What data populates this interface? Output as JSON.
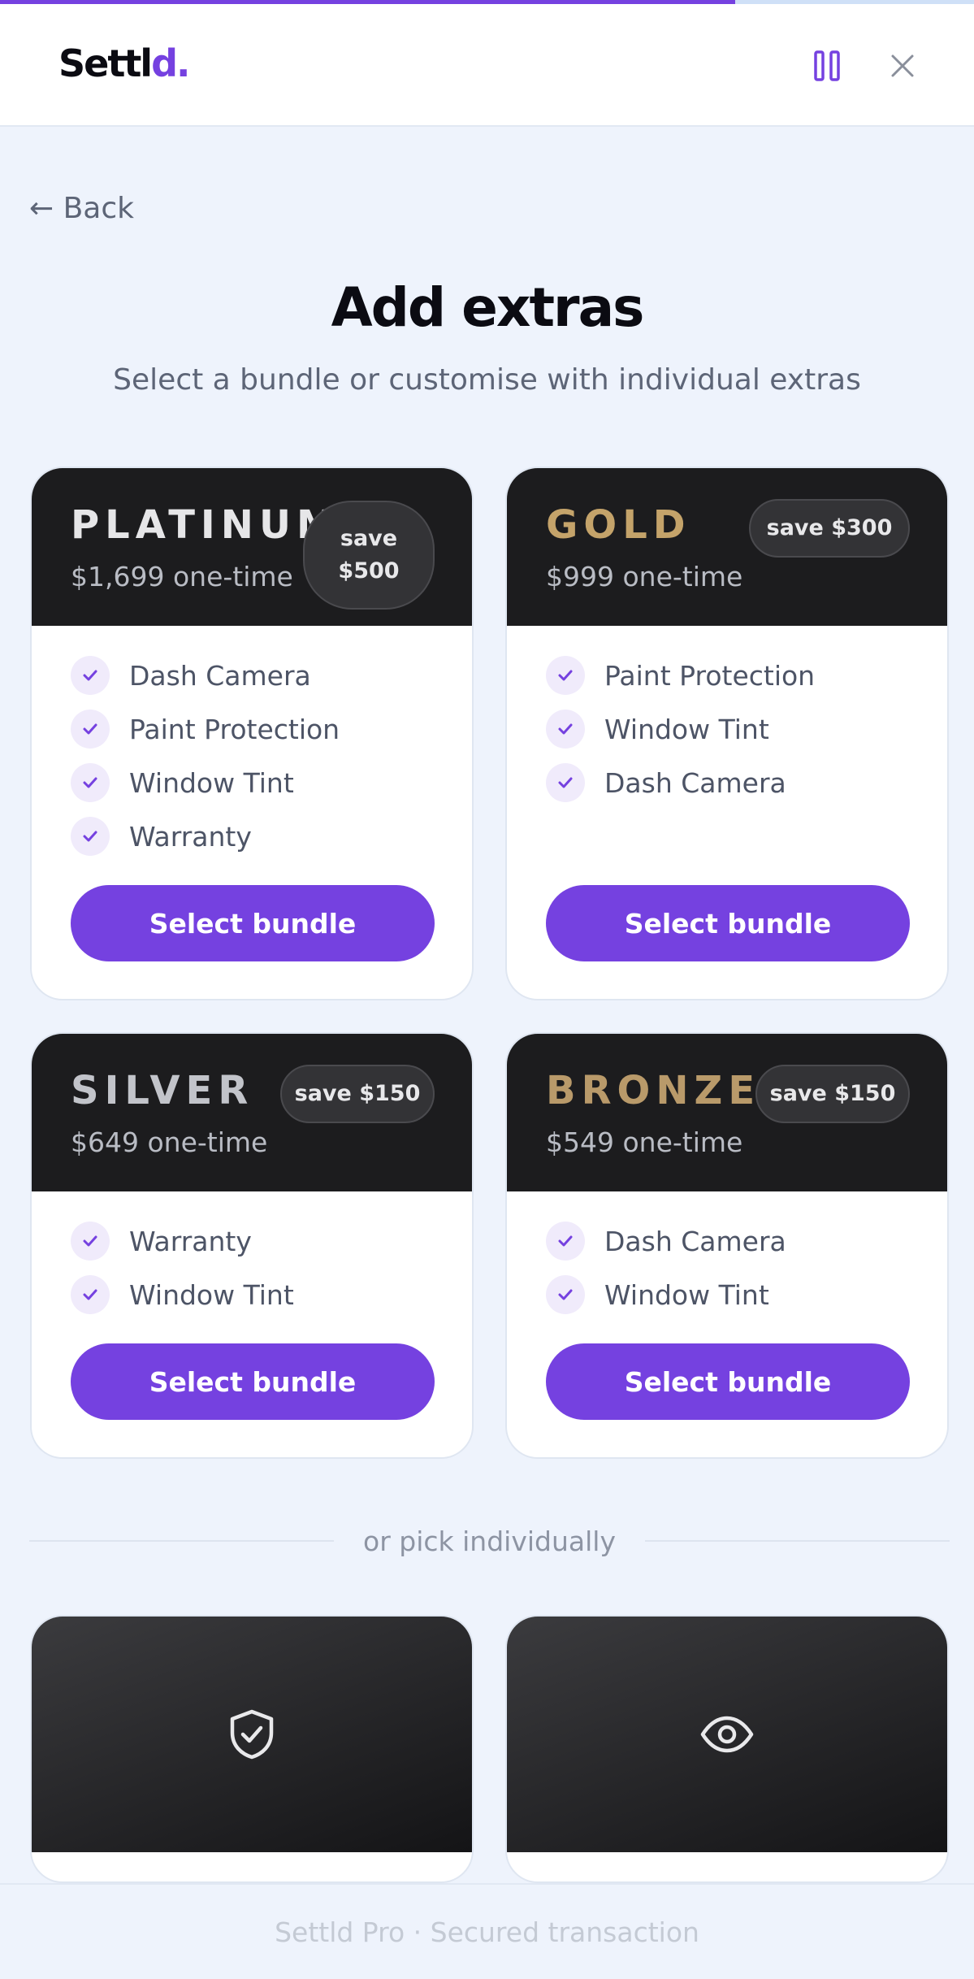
{
  "progress": {
    "fraction": 0.755
  },
  "header": {
    "logo_main": "Settl",
    "logo_accent": "d.",
    "pause_icon": "pause-icon",
    "close_icon": "close-icon"
  },
  "nav": {
    "back_label": "← Back"
  },
  "page": {
    "title": "Add extras",
    "subtitle": "Select a bundle or customise with individual extras"
  },
  "bundles": [
    {
      "tier": "PLATINUM",
      "tier_color": "#e6e6e8",
      "price": "$1,699 one-time",
      "save_line1": "save",
      "save_line2": "$500",
      "features": [
        "Dash Camera",
        "Paint Protection",
        "Window Tint",
        "Warranty"
      ],
      "button": "Select bundle"
    },
    {
      "tier": "GOLD",
      "tier_color": "#c4a36a",
      "price": "$999 one-time",
      "save": "save $300",
      "features": [
        "Paint Protection",
        "Window Tint",
        "Dash Camera"
      ],
      "button": "Select bundle"
    },
    {
      "tier": "SILVER",
      "tier_color": "#c2c4ca",
      "price": "$649 one-time",
      "save": "save $150",
      "features": [
        "Warranty",
        "Window Tint"
      ],
      "button": "Select bundle"
    },
    {
      "tier": "BRONZE",
      "tier_color": "#b99a6a",
      "price": "$549 one-time",
      "save": "save $150",
      "features": [
        "Dash Camera",
        "Window Tint"
      ],
      "button": "Select bundle"
    }
  ],
  "divider": {
    "label": "or pick individually"
  },
  "extras": [
    {
      "icon": "shield-check-icon"
    },
    {
      "icon": "eye-icon"
    }
  ],
  "footer": {
    "text": "Settld Pro · Secured transaction"
  },
  "colors": {
    "accent": "#7541e0",
    "card_head": "#1c1c1e",
    "background": "#eef3fc"
  }
}
